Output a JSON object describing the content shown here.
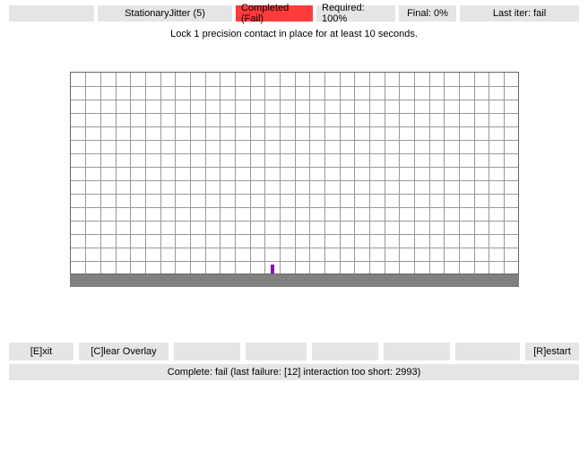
{
  "header": {
    "name": "StationaryJitter (5)",
    "status": "Completed (Fail)",
    "required": "Required: 100%",
    "final": "Final: 0%",
    "last_iter": "Last iter: fail"
  },
  "instruction": "Lock 1 precision contact in place for at least 10 seconds.",
  "grid": {
    "cols": 30,
    "rows": 15,
    "cursor": {
      "col": 13,
      "bottom": 0
    }
  },
  "buttons": {
    "exit": "[E]xit",
    "clear": "[C]lear Overlay",
    "restart": "[R]estart"
  },
  "status": "Complete: fail (last failure: [12] interaction too short: 2993)"
}
